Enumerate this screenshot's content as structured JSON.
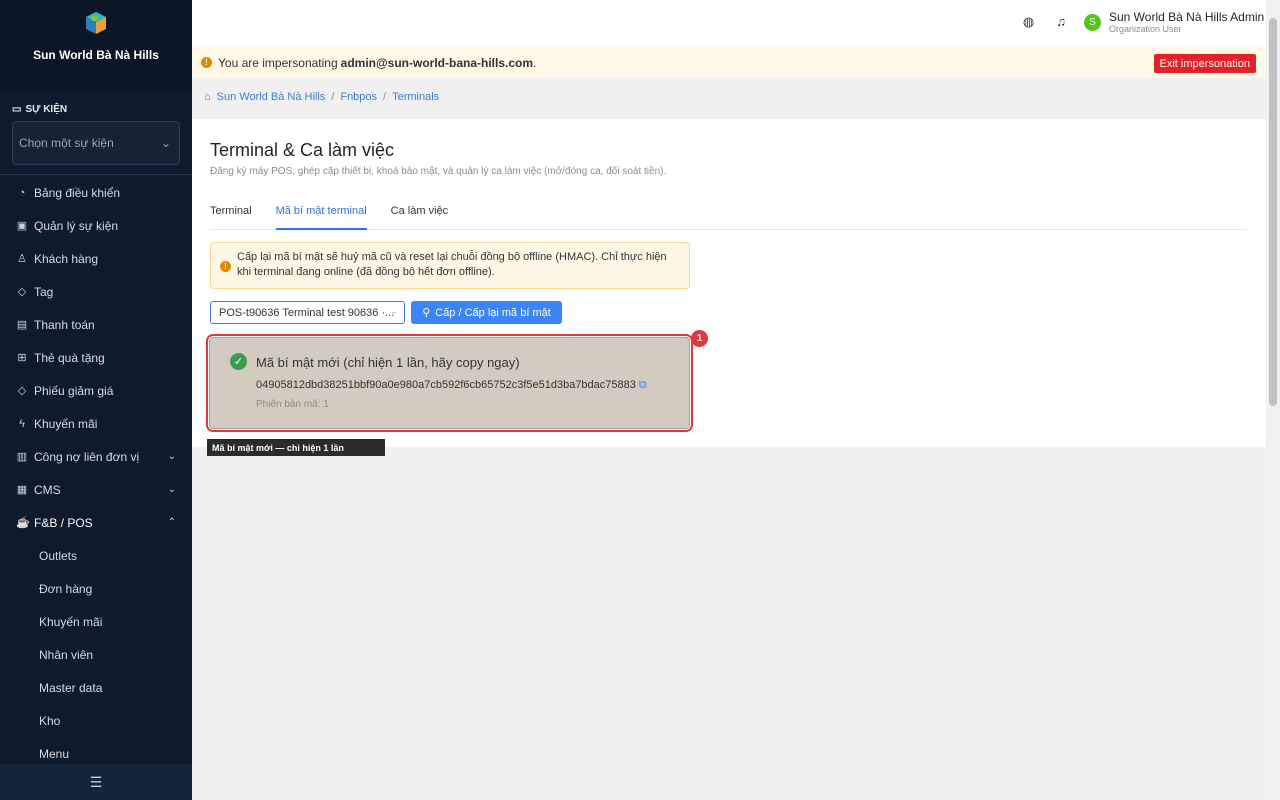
{
  "sidebar": {
    "org_name": "Sun World Bà Nà Hills",
    "section_label": "SỰ KIỆN",
    "event_placeholder": "Chọn một sự kiện",
    "items": [
      {
        "label": "Bảng điều khiển",
        "icon": "gauge-icon"
      },
      {
        "label": "Quản lý sự kiện",
        "icon": "calendar-icon"
      },
      {
        "label": "Khách hàng",
        "icon": "user-icon"
      },
      {
        "label": "Tag",
        "icon": "tag-icon"
      },
      {
        "label": "Thanh toán",
        "icon": "card-icon"
      },
      {
        "label": "Thẻ quà tặng",
        "icon": "gift-icon"
      },
      {
        "label": "Phiếu giảm giá",
        "icon": "ticket-icon"
      },
      {
        "label": "Khuyến mãi",
        "icon": "bolt-icon"
      },
      {
        "label": "Công nợ liên đơn vị",
        "icon": "ledger-icon"
      },
      {
        "label": "CMS",
        "icon": "cms-icon"
      },
      {
        "label": "F&B / POS",
        "icon": "cup-icon"
      }
    ],
    "sub_items": [
      "Outlets",
      "Đơn hàng",
      "Khuyến mãi",
      "Nhân viên",
      "Master data",
      "Kho",
      "Menu"
    ]
  },
  "header": {
    "user_name": "Sun World Bà Nà Hills Admin",
    "user_role": "Organization User",
    "avatar_letter": "S"
  },
  "impersonation": {
    "text": "You are impersonating",
    "email": "admin@sun-world-bana-hills.com",
    "exit_label": "Exit impersonation"
  },
  "breadcrumb": [
    "Sun World Bà Nà Hills",
    "Fnbpos",
    "Terminals"
  ],
  "page": {
    "title": "Terminal & Ca làm việc",
    "description": "Đăng ký máy POS, ghép cặp thiết bị, khoá bảo mật, và quản lý ca làm việc (mở/đóng ca, đối soát tiền).",
    "tabs": [
      "Terminal",
      "Mã bí mật terminal",
      "Ca làm việc"
    ],
    "active_tab": 1,
    "alert_text": "Cấp lại mã bí mật sẽ huỷ mã cũ và reset lại chuỗi đồng bộ offline (HMAC). Chỉ thực hiện khi terminal đang online (đã đồng bộ hết đơn offline).",
    "terminal_value": "POS-t90636 Terminal test 90636 ·...",
    "issue_button": "Cấp / Cấp lại mã bí mật",
    "result_title": "Mã bí mật mới (chỉ hiện 1 lần, hãy copy ngay)",
    "secret": "04905812dbd38251bbf90a0e980a7cb592f6cb65752c3f5e51d3ba7bdac75883",
    "version_text": "Phiên bản mã: 1",
    "badge": "1",
    "tooltip": "Mã bí mật mới — chỉ hiện 1 lần"
  }
}
